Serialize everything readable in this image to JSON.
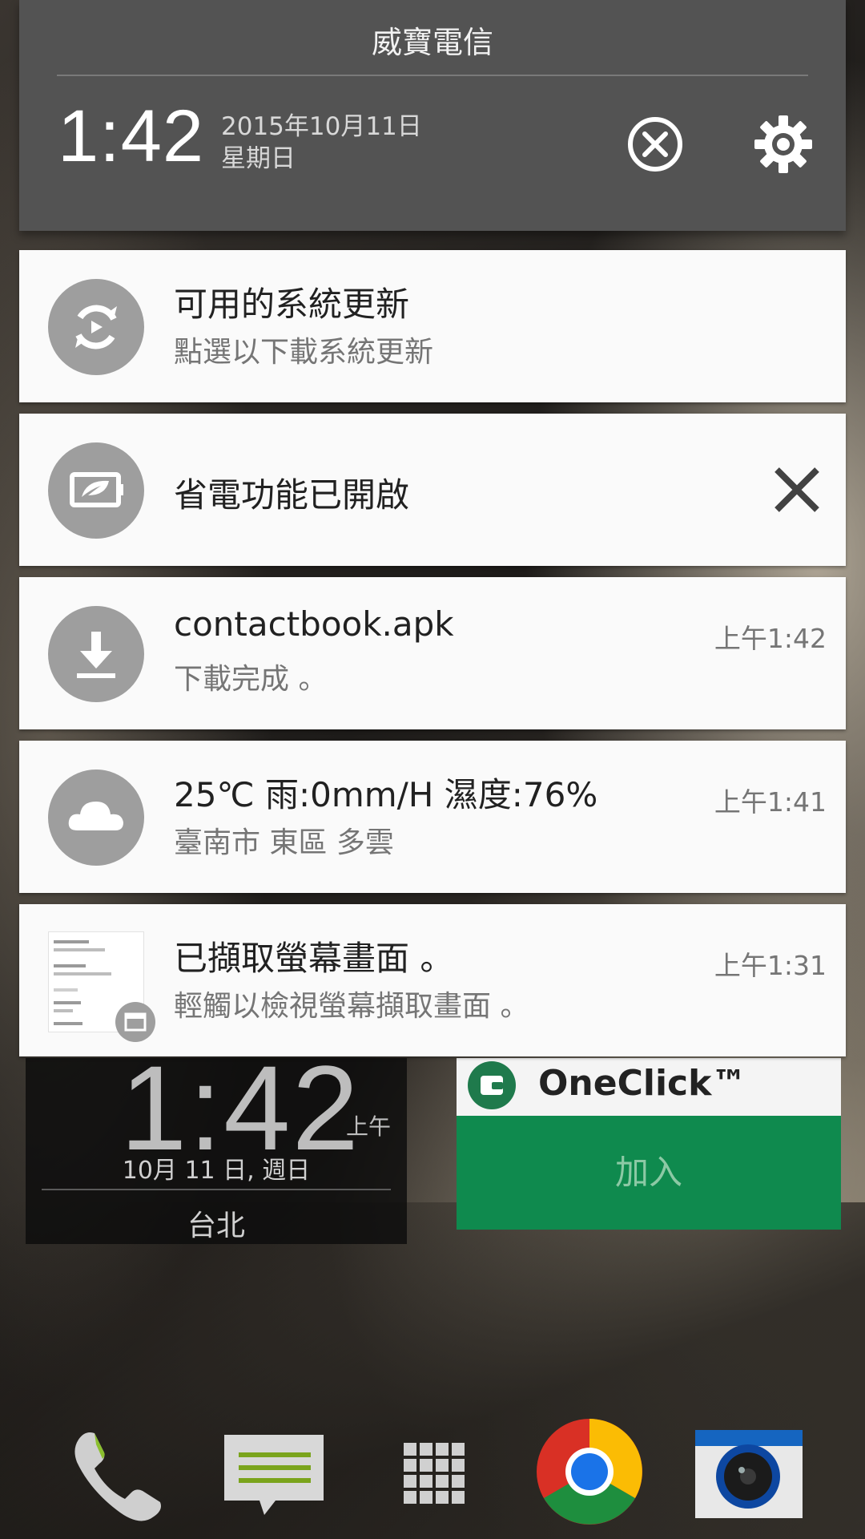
{
  "status_header": {
    "carrier": "威寶電信",
    "time": "1:42",
    "date": "2015年10月11日",
    "weekday": "星期日",
    "clear_icon": "clear-all-icon",
    "settings_icon": "gear-icon"
  },
  "notifications": [
    {
      "icon": "system-update-icon",
      "title": "可用的系統更新",
      "subtitle": "點選以下載系統更新",
      "time": ""
    },
    {
      "icon": "battery-saver-icon",
      "title": "省電功能已開啟",
      "subtitle": "",
      "time": "",
      "dismiss_icon": "close-icon"
    },
    {
      "icon": "download-icon",
      "title": "contactbook.apk",
      "subtitle": "下載完成 。",
      "time": "上午1:42"
    },
    {
      "icon": "cloud-icon",
      "title": "25℃   雨:0mm/H   濕度:76%",
      "subtitle": "臺南市 東區        多雲",
      "time": "上午1:41"
    },
    {
      "icon": "screenshot-thumbnail",
      "title": "已擷取螢幕畫面 。",
      "subtitle": "輕觸以檢視螢幕擷取畫面 。",
      "time": "上午1:31"
    }
  ],
  "home": {
    "clock_widget": {
      "time": "1:42",
      "ampm": "上午",
      "date": "10月 11 日, 週日",
      "city": "台北"
    },
    "oneclick_widget": {
      "label": "OneClick™",
      "button": "加入"
    },
    "dock": [
      "phone-icon",
      "messages-icon",
      "app-drawer-icon",
      "chrome-icon",
      "camera-icon"
    ]
  },
  "colors": {
    "header_bg": "#535353",
    "card_bg": "#fafafa",
    "icon_circle": "#9e9e9e",
    "oneclick_green": "#0f8a4e"
  }
}
